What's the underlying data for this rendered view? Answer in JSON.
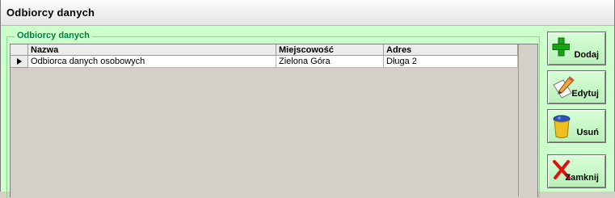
{
  "window": {
    "title": "Odbiorcy danych"
  },
  "group": {
    "legend": "Odbiorcy danych"
  },
  "grid": {
    "columns": [
      "Nazwa",
      "Miejscowość",
      "Adres"
    ],
    "rows": [
      [
        "Odbiorca danych osobowych",
        "Zielona Góra",
        "Długa 2"
      ]
    ]
  },
  "buttons": {
    "add": "Dodaj",
    "edit": "Edytuj",
    "delete": "Usuń",
    "close": "Zamknij"
  },
  "icons": {
    "add": "plus-icon",
    "edit": "pencil-icon",
    "delete": "trash-bin-icon",
    "close": "x-icon"
  },
  "colors": {
    "panel": "#ccffcc",
    "legend_text": "#008040"
  }
}
